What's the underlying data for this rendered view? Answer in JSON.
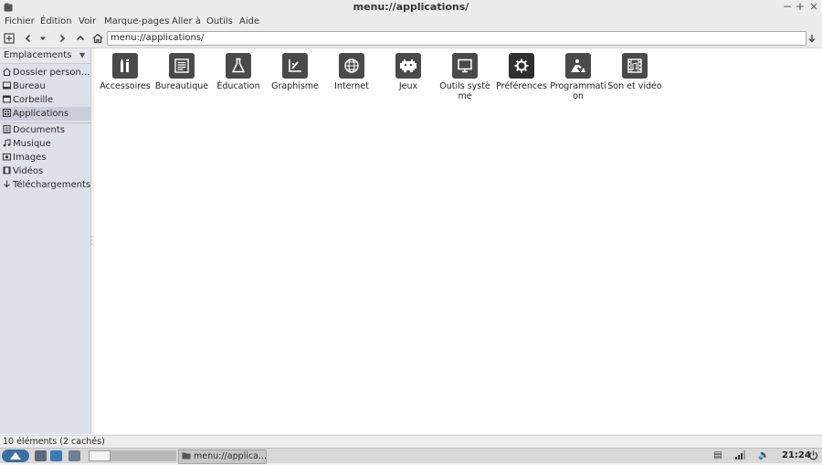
{
  "window": {
    "title": "menu://applications/"
  },
  "menubar": {
    "items": [
      "Fichier",
      "Édition",
      "Voir",
      "Marque-pages",
      "Aller à",
      "Outils",
      "Aide"
    ]
  },
  "toolbar": {
    "address": "menu://applications/"
  },
  "sidebar": {
    "header": "Emplacements",
    "items": [
      {
        "label": "Dossier person...",
        "icon": "home-icon"
      },
      {
        "label": "Bureau",
        "icon": "desktop-icon"
      },
      {
        "label": "Corbeille",
        "icon": "trash-icon"
      },
      {
        "label": "Applications",
        "icon": "applications-icon",
        "selected": true
      },
      {
        "label": "Documents",
        "icon": "documents-icon"
      },
      {
        "label": "Musique",
        "icon": "music-icon"
      },
      {
        "label": "Images",
        "icon": "pictures-icon"
      },
      {
        "label": "Vidéos",
        "icon": "videos-icon"
      },
      {
        "label": "Téléchargements",
        "icon": "download-icon"
      }
    ]
  },
  "main": {
    "apps": [
      {
        "label": "Accessoires",
        "icon": "accessories-icon"
      },
      {
        "label": "Bureautique",
        "icon": "office-icon"
      },
      {
        "label": "Éducation",
        "icon": "education-icon"
      },
      {
        "label": "Graphisme",
        "icon": "graphics-icon"
      },
      {
        "label": "Internet",
        "icon": "internet-icon"
      },
      {
        "label": "Jeux",
        "icon": "games-icon"
      },
      {
        "label": "Outils système",
        "icon": "system-tools-icon"
      },
      {
        "label": "Préférences",
        "icon": "preferences-icon"
      },
      {
        "label": "Programmation",
        "icon": "programming-icon"
      },
      {
        "label": "Son et vidéo",
        "icon": "sound-video-icon"
      }
    ]
  },
  "status": {
    "text": "10 éléments (2 cachés)"
  },
  "taskbar": {
    "task_label": "menu://applica...",
    "clock": "21:24"
  }
}
